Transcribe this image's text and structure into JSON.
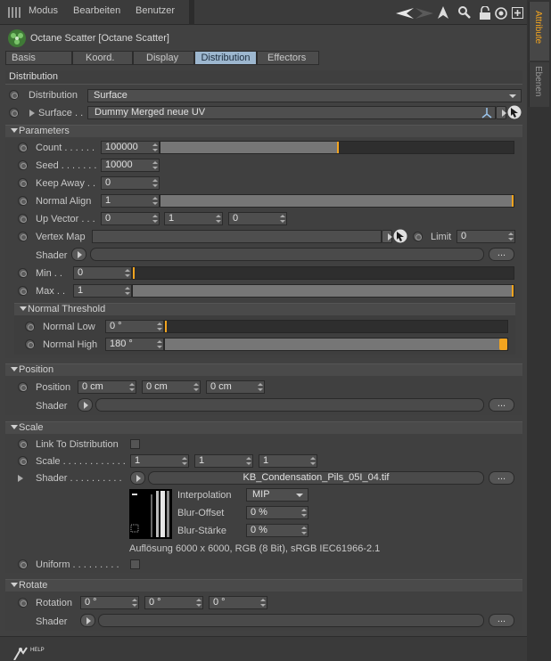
{
  "menubar": {
    "items": [
      "Modus",
      "Bearbeiten",
      "Benutzer"
    ]
  },
  "right_tabs": [
    "Attribute",
    "Ebenen"
  ],
  "object_title": "Octane Scatter [Octane Scatter]",
  "tabs": [
    "Basis",
    "Koord.",
    "Display",
    "Distribution",
    "Effectors"
  ],
  "active_tab": "Distribution",
  "distribution": {
    "section_title": "Distribution",
    "distribution_label": "Distribution",
    "distribution_value": "Surface",
    "surface_label": "Surface . .",
    "surface_value": "Dummy Merged neue UV"
  },
  "parameters": {
    "title": "Parameters",
    "count_label": "Count . . . . . .",
    "count_value": "100000",
    "count_fraction": 0.5,
    "seed_label": "Seed . . . . . . .",
    "seed_value": "10000",
    "keepaway_label": "Keep Away . .",
    "keepaway_value": "0",
    "normalalign_label": "Normal Align",
    "normalalign_value": "1",
    "normalalign_fraction": 1.0,
    "upvector_label": "Up Vector . . .",
    "upvector_values": [
      "0",
      "1",
      "0"
    ],
    "vertexmap_label": "Vertex Map",
    "limit_label": "Limit",
    "limit_value": "0",
    "shader_label": "Shader",
    "dots": "...",
    "min_label": "Min . .",
    "min_value": "0",
    "min_fraction": 0.0,
    "max_label": "Max . .",
    "max_value": "1",
    "max_fraction": 1.0
  },
  "normal_threshold": {
    "title": "Normal Threshold",
    "low_label": "Normal Low",
    "low_value": "0 °",
    "low_fraction": 0.0,
    "high_label": "Normal High",
    "high_value": "180 °",
    "high_fraction": 1.0
  },
  "position": {
    "title": "Position",
    "label": "Position",
    "values": [
      "0 cm",
      "0 cm",
      "0 cm"
    ],
    "shader_label": "Shader"
  },
  "scale": {
    "title": "Scale",
    "link_label": "Link To Distribution",
    "scale_label": "Scale . . . . . . . . . . . .",
    "values": [
      "1",
      "1",
      "1"
    ],
    "shader_label": "Shader . . . . . . . . . .",
    "shader_file": "KB_Condensation_Pils_05I_04.tif",
    "interpolation_label": "Interpolation",
    "interpolation_value": "MIP",
    "bluroffset_label": "Blur-Offset",
    "bluroffset_value": "0 %",
    "blurstaerke_label": "Blur-Stärke",
    "blurstaerke_value": "0 %",
    "info": "Auflösung 6000 x 6000, RGB (8 Bit), sRGB IEC61966-2.1",
    "uniform_label": "Uniform . . . . . . . . ."
  },
  "rotate": {
    "title": "Rotate",
    "label": "Rotation",
    "values": [
      "0 °",
      "0 °",
      "0 °"
    ],
    "shader_label": "Shader"
  },
  "footer": {
    "help_label": "HELP"
  },
  "colors": {
    "accent_orange": "#f2a41f",
    "active_tab": "#9db7cf"
  }
}
